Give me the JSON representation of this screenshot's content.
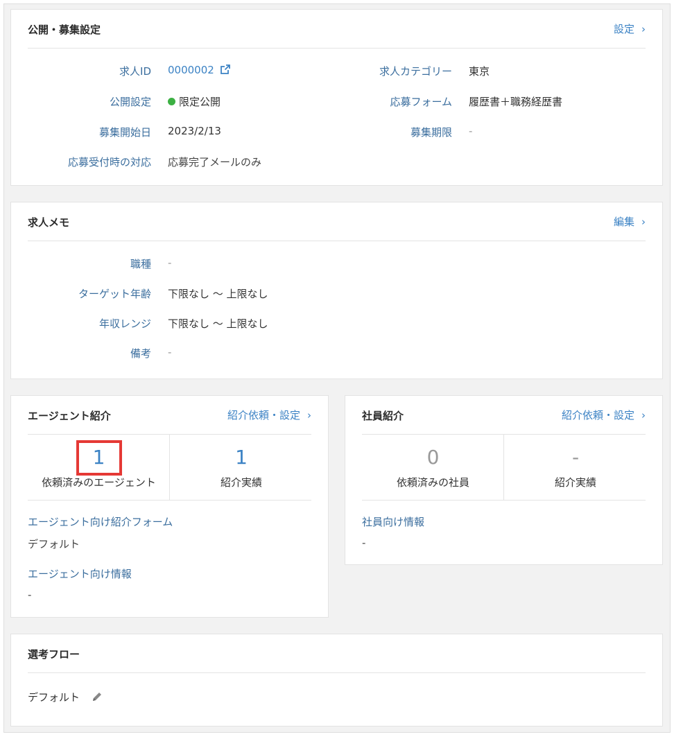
{
  "public_settings": {
    "title": "公開・募集設定",
    "link_label": "設定",
    "job_id_label": "求人ID",
    "job_id_value": "0000002",
    "visibility_label": "公開設定",
    "visibility_value": "限定公開",
    "visibility_color": "#3cb043",
    "start_label": "募集開始日",
    "start_value": "2023/2/13",
    "response_label": "応募受付時の対応",
    "response_value": "応募完了メールのみ",
    "category_label": "求人カテゴリー",
    "category_value": "東京",
    "form_label": "応募フォーム",
    "form_value": "履歴書＋職務経歴書",
    "deadline_label": "募集期限",
    "deadline_value": "-"
  },
  "job_memo": {
    "title": "求人メモ",
    "link_label": "編集",
    "occupation_label": "職種",
    "occupation_value": "-",
    "age_label": "ターゲット年齢",
    "age_value": "下限なし ～ 上限なし",
    "salary_label": "年収レンジ",
    "salary_value": "下限なし ～ 上限なし",
    "notes_label": "備考",
    "notes_value": "-"
  },
  "agent_referral": {
    "title": "エージェント紹介",
    "link_label": "紹介依頼・設定",
    "requested_count": "1",
    "requested_label": "依頼済みのエージェント",
    "results_count": "1",
    "results_label": "紹介実績",
    "form_label": "エージェント向け紹介フォーム",
    "form_value": "デフォルト",
    "info_label": "エージェント向け情報",
    "info_value": "-"
  },
  "employee_referral": {
    "title": "社員紹介",
    "link_label": "紹介依頼・設定",
    "requested_count": "0",
    "requested_label": "依頼済みの社員",
    "results_count": "-",
    "results_label": "紹介実績",
    "info_label": "社員向け情報",
    "info_value": "-"
  },
  "selection_flow": {
    "title": "選考フロー",
    "value": "デフォルト"
  },
  "colors": {
    "link": "#3b82c4",
    "label": "#3b6e9e",
    "highlight": "#e53935"
  },
  "icons": {
    "external": "external-link-icon",
    "edit": "pencil-icon",
    "chevron": "chevron-right-icon"
  }
}
